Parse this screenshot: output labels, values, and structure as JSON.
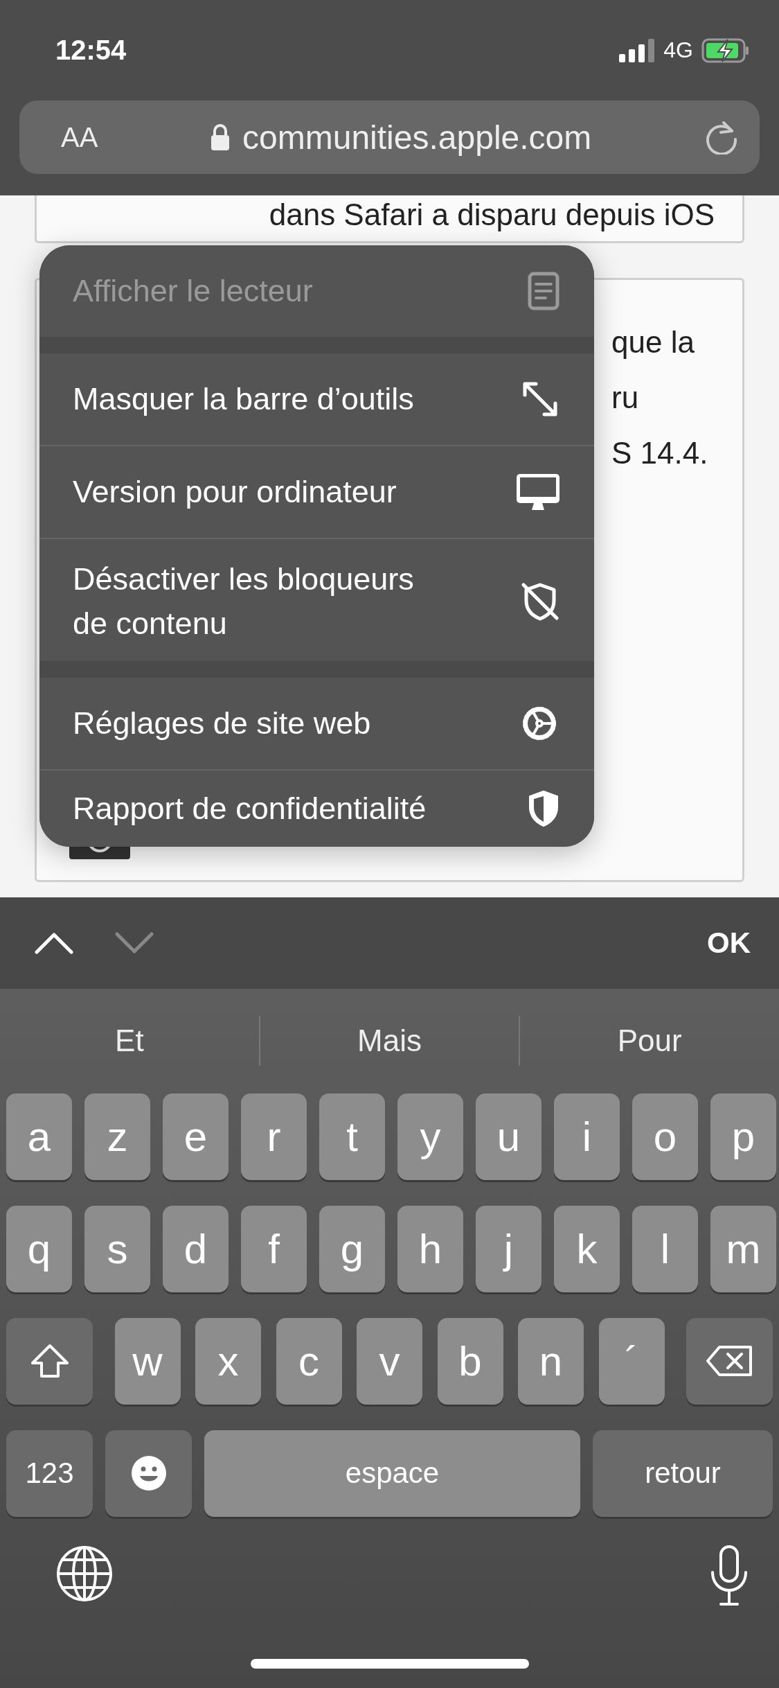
{
  "status_bar": {
    "time": "12:54",
    "network": "4G"
  },
  "address_bar": {
    "text_size": "AA",
    "url": "communities.apple.com"
  },
  "page": {
    "cards": [
      {
        "lines": [
          "dans Safari a disparu depuis iOS"
        ]
      },
      {
        "lines": [
          "que la",
          "ru",
          "S 14.4."
        ]
      }
    ]
  },
  "menu": {
    "groups": [
      [
        {
          "label": "Afficher le lecteur",
          "disabled": true
        }
      ],
      [
        {
          "label": "Masquer la barre d’outils",
          "disabled": false
        },
        {
          "label": "Version pour ordinateur",
          "disabled": false
        },
        {
          "label": "Désactiver les bloqueurs de contenu",
          "disabled": false
        }
      ],
      [
        {
          "label": "Réglages de site web",
          "disabled": false
        },
        {
          "label": "Rapport de confidentialité",
          "disabled": false
        }
      ]
    ]
  },
  "form_toolbar": {
    "previous_disabled": false,
    "next_disabled": true,
    "done": "OK"
  },
  "keyboard": {
    "suggestions": [
      "Et",
      "Mais",
      "Pour"
    ],
    "rows": [
      {
        "keys": [
          {
            "kind": "letter",
            "label": "a"
          },
          {
            "kind": "letter",
            "label": "z"
          },
          {
            "kind": "letter",
            "label": "e"
          },
          {
            "kind": "letter",
            "label": "r"
          },
          {
            "kind": "letter",
            "label": "t"
          },
          {
            "kind": "letter",
            "label": "y"
          },
          {
            "kind": "letter",
            "label": "u"
          },
          {
            "kind": "letter",
            "label": "i"
          },
          {
            "kind": "letter",
            "label": "o"
          },
          {
            "kind": "letter",
            "label": "p"
          }
        ]
      },
      {
        "keys": [
          {
            "kind": "letter",
            "label": "q"
          },
          {
            "kind": "letter",
            "label": "s"
          },
          {
            "kind": "letter",
            "label": "d"
          },
          {
            "kind": "letter",
            "label": "f"
          },
          {
            "kind": "letter",
            "label": "g"
          },
          {
            "kind": "letter",
            "label": "h"
          },
          {
            "kind": "letter",
            "label": "j"
          },
          {
            "kind": "letter",
            "label": "k"
          },
          {
            "kind": "letter",
            "label": "l"
          },
          {
            "kind": "letter",
            "label": "m"
          }
        ]
      },
      {
        "keys": [
          {
            "kind": "shift"
          },
          {
            "kind": "letter",
            "label": "w"
          },
          {
            "kind": "letter",
            "label": "x"
          },
          {
            "kind": "letter",
            "label": "c"
          },
          {
            "kind": "letter",
            "label": "v"
          },
          {
            "kind": "letter",
            "label": "b"
          },
          {
            "kind": "letter",
            "label": "n"
          },
          {
            "kind": "letter",
            "label": "´"
          },
          {
            "kind": "delete"
          }
        ]
      },
      {
        "keys": [
          {
            "kind": "numbers",
            "label": "123"
          },
          {
            "kind": "emoji"
          },
          {
            "kind": "space",
            "label": "espace"
          },
          {
            "kind": "return",
            "label": "retour"
          }
        ]
      }
    ]
  }
}
